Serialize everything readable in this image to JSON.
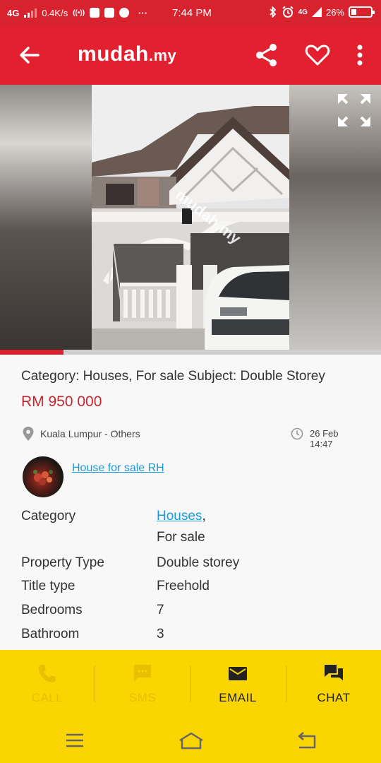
{
  "status_bar": {
    "network": "4G",
    "speed": "0.4K/s",
    "time": "7:44 PM",
    "network_right": "4G",
    "battery": "26%",
    "overflow": "···"
  },
  "app_bar": {
    "logo_main": "mudah",
    "logo_tld": ".my"
  },
  "gallery": {
    "progress": 0.167,
    "watermark": "mudah.my"
  },
  "listing": {
    "subject": "Category: Houses, For sale Subject: Double Storey",
    "price": "RM 950 000",
    "location": "Kuala Lumpur - Others",
    "date": "26 Feb 14:47",
    "seller": "House for sale RH"
  },
  "details": {
    "category_label": "Category",
    "category_value_link": "Houses",
    "category_value_sep": ",",
    "category_value_line2": "For sale",
    "property_type_label": "Property Type",
    "property_type_value": "Double storey",
    "title_type_label": "Title type",
    "title_type_value": "Freehold",
    "bedrooms_label": "Bedrooms",
    "bedrooms_value": "7",
    "bathroom_label": "Bathroom",
    "bathroom_value": "3"
  },
  "actions": {
    "call": "CALL",
    "sms": "SMS",
    "email": "EMAIL",
    "chat": "CHAT"
  },
  "colors": {
    "brand_red": "#e2202f",
    "price_red": "#c3272f",
    "link_blue": "#1c9ad6",
    "action_yellow": "#fbd500"
  }
}
